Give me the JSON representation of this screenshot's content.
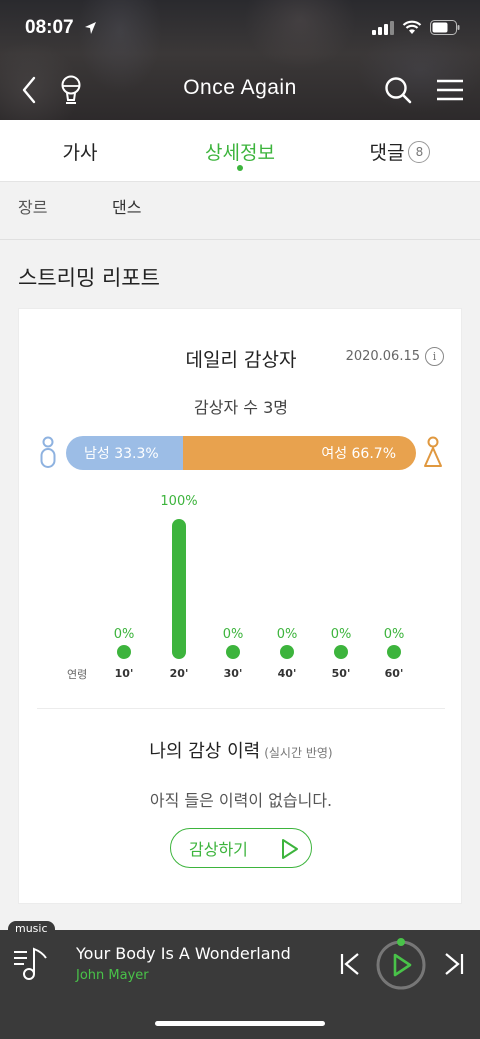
{
  "status": {
    "time": "08:07"
  },
  "nav": {
    "title": "Once Again"
  },
  "tabs": [
    {
      "label": "가사"
    },
    {
      "label": "상세정보"
    },
    {
      "label": "댓글",
      "badge": "8"
    }
  ],
  "genre": {
    "key": "장르",
    "value": "댄스"
  },
  "section_title": "스트리밍 리포트",
  "report": {
    "title": "데일리 감상자",
    "date": "2020.06.15",
    "info_glyph": "i",
    "listeners": "감상자 수 3명",
    "male_label": "남성 33.3%",
    "female_label": "여성 66.7%",
    "male_ratio": 0.333,
    "age_caption": "연령"
  },
  "chart_data": {
    "type": "bar",
    "categories": [
      "10'",
      "20'",
      "30'",
      "40'",
      "50'",
      "60'"
    ],
    "values": [
      0,
      100,
      0,
      0,
      0,
      0
    ],
    "labels": [
      "0%",
      "100%",
      "0%",
      "0%",
      "0%",
      "0%"
    ],
    "ylim": [
      0,
      100
    ],
    "xlabel": "연령",
    "ylabel": "",
    "title": ""
  },
  "history": {
    "title": "나의 감상 이력",
    "note": "(실시간 반영)",
    "empty": "아직 들은 이력이 없습니다.",
    "button": "감상하기"
  },
  "player": {
    "tag": "music",
    "song": "Your Body Is A Wonderland",
    "artist": "John Mayer"
  },
  "colors": {
    "accent": "#3db43d",
    "male": "#9cbde6",
    "female": "#e8a24e"
  }
}
